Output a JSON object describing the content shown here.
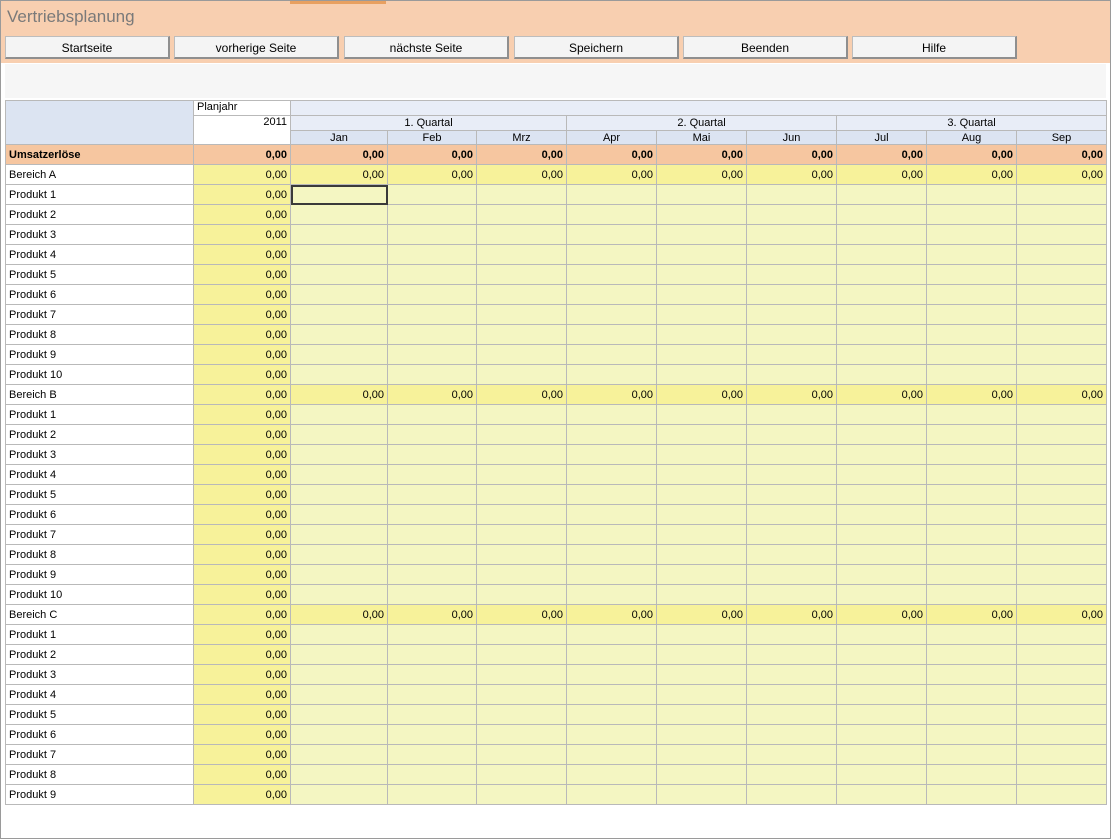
{
  "app": {
    "title": "Vertriebsplanung"
  },
  "nav": [
    {
      "label": "Startseite"
    },
    {
      "label": "vorherige Seite"
    },
    {
      "label": "nächste Seite"
    },
    {
      "label": "Speichern"
    },
    {
      "label": "Beenden"
    },
    {
      "label": "Hilfe"
    }
  ],
  "header": {
    "plan_label": "Planjahr",
    "year": "2011",
    "quarters": [
      "1. Quartal",
      "2. Quartal",
      "3. Quartal"
    ],
    "months": [
      "Jan",
      "Feb",
      "Mrz",
      "Apr",
      "Mai",
      "Jun",
      "Jul",
      "Aug",
      "Sep"
    ]
  },
  "totals": {
    "label": "Umsatzerlöse",
    "year_value": "0,00",
    "months": [
      "0,00",
      "0,00",
      "0,00",
      "0,00",
      "0,00",
      "0,00",
      "0,00",
      "0,00",
      "0,00"
    ]
  },
  "sections": [
    {
      "name": "Bereich A",
      "year_value": "0,00",
      "months": [
        "0,00",
        "0,00",
        "0,00",
        "0,00",
        "0,00",
        "0,00",
        "0,00",
        "0,00",
        "0,00"
      ],
      "products": [
        {
          "name": "Produkt 1",
          "value": "0,00"
        },
        {
          "name": "Produkt 2",
          "value": "0,00"
        },
        {
          "name": "Produkt 3",
          "value": "0,00"
        },
        {
          "name": "Produkt 4",
          "value": "0,00"
        },
        {
          "name": "Produkt 5",
          "value": "0,00"
        },
        {
          "name": "Produkt 6",
          "value": "0,00"
        },
        {
          "name": "Produkt 7",
          "value": "0,00"
        },
        {
          "name": "Produkt 8",
          "value": "0,00"
        },
        {
          "name": "Produkt 9",
          "value": "0,00"
        },
        {
          "name": "Produkt 10",
          "value": "0,00"
        }
      ]
    },
    {
      "name": "Bereich B",
      "year_value": "0,00",
      "months": [
        "0,00",
        "0,00",
        "0,00",
        "0,00",
        "0,00",
        "0,00",
        "0,00",
        "0,00",
        "0,00"
      ],
      "products": [
        {
          "name": "Produkt 1",
          "value": "0,00"
        },
        {
          "name": "Produkt 2",
          "value": "0,00"
        },
        {
          "name": "Produkt 3",
          "value": "0,00"
        },
        {
          "name": "Produkt 4",
          "value": "0,00"
        },
        {
          "name": "Produkt 5",
          "value": "0,00"
        },
        {
          "name": "Produkt 6",
          "value": "0,00"
        },
        {
          "name": "Produkt 7",
          "value": "0,00"
        },
        {
          "name": "Produkt 8",
          "value": "0,00"
        },
        {
          "name": "Produkt 9",
          "value": "0,00"
        },
        {
          "name": "Produkt 10",
          "value": "0,00"
        }
      ]
    },
    {
      "name": "Bereich C",
      "year_value": "0,00",
      "months": [
        "0,00",
        "0,00",
        "0,00",
        "0,00",
        "0,00",
        "0,00",
        "0,00",
        "0,00",
        "0,00"
      ],
      "products": [
        {
          "name": "Produkt 1",
          "value": "0,00"
        },
        {
          "name": "Produkt 2",
          "value": "0,00"
        },
        {
          "name": "Produkt 3",
          "value": "0,00"
        },
        {
          "name": "Produkt 4",
          "value": "0,00"
        },
        {
          "name": "Produkt 5",
          "value": "0,00"
        },
        {
          "name": "Produkt 6",
          "value": "0,00"
        },
        {
          "name": "Produkt 7",
          "value": "0,00"
        },
        {
          "name": "Produkt 8",
          "value": "0,00"
        },
        {
          "name": "Produkt 9",
          "value": "0,00"
        }
      ]
    }
  ],
  "colors": {
    "titlebar": "#f8cfb0",
    "totals_row": "#f6c6a0",
    "year_column": "#f7f29a",
    "input_cells": "#f4f6c2",
    "header": "#dce4f2"
  }
}
